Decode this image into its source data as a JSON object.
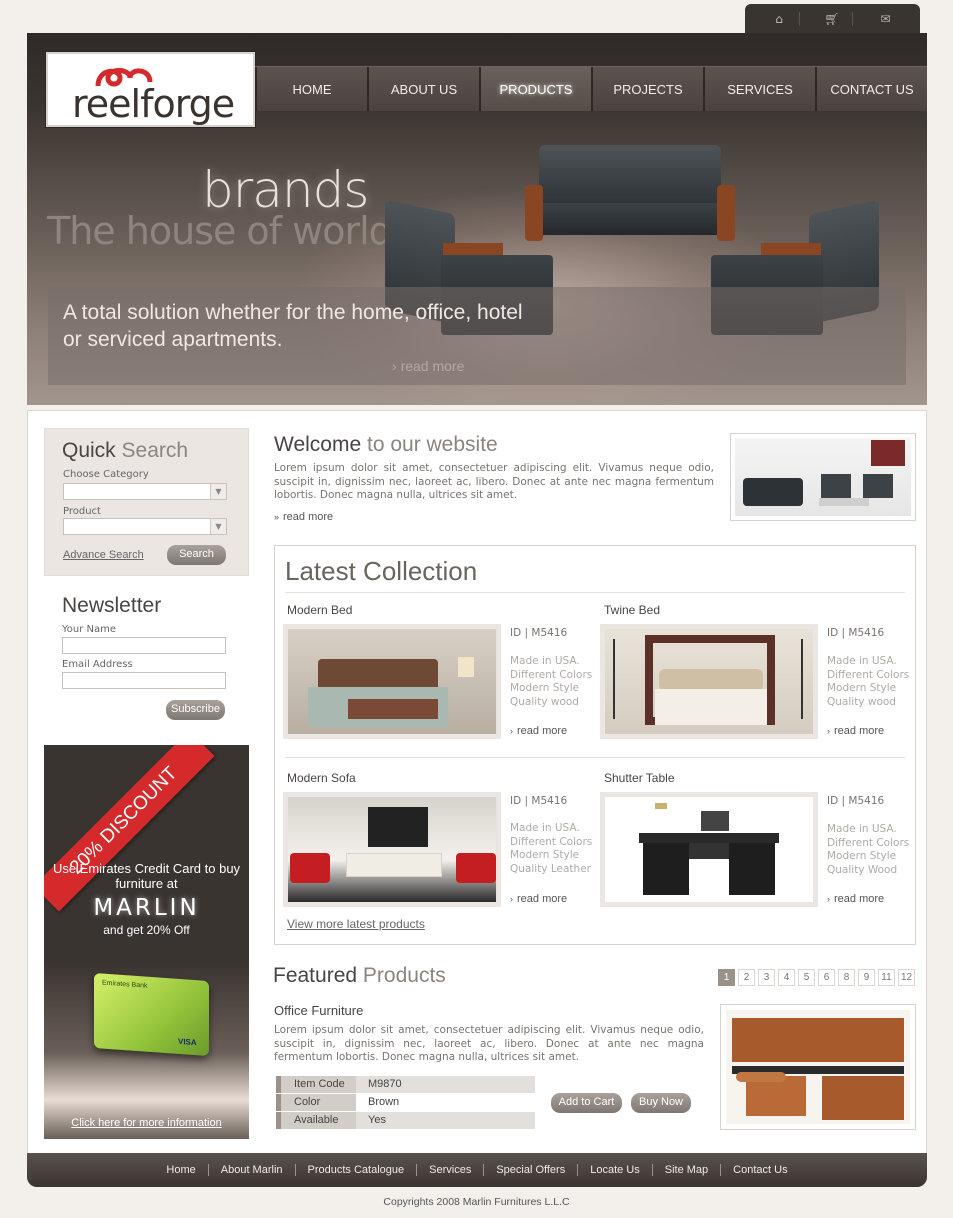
{
  "top_icons": [
    "home-icon",
    "cart-icon",
    "mail-icon"
  ],
  "logo": {
    "text": "reelforge"
  },
  "nav": [
    {
      "label": "HOME"
    },
    {
      "label": "ABOUT US"
    },
    {
      "label": "PRODUCTS",
      "active": true
    },
    {
      "label": "PROJECTS"
    },
    {
      "label": "SERVICES"
    },
    {
      "label": "CONTACT US"
    }
  ],
  "hero": {
    "brands": "brands",
    "tagline": "The house of world",
    "banner_text": "A total solution whether for the home, office, hotel or serviced apartments.",
    "read_more": "read more"
  },
  "quick_search": {
    "title_main": "Quick",
    "title_light": "Search",
    "category_label": "Choose Category",
    "product_label": "Product",
    "advance_link": "Advance Search",
    "search_button": "Search"
  },
  "newsletter": {
    "title": "Newsletter",
    "name_label": "Your Name",
    "email_label": "Email Address",
    "subscribe_button": "Subscribe"
  },
  "promo": {
    "ribbon": "20% DISCOUNT",
    "line1": "Use Emirates Credit Card to buy furniture at",
    "brand": "MARLIN",
    "line2": "and get 20% Off",
    "card_bank": "Emirates Bank",
    "card_brand": "VISA",
    "link": "Click here for more information"
  },
  "welcome": {
    "title_main": "Welcome",
    "title_light": "to our website",
    "text": "Lorem ipsum dolor sit amet, consectetuer adipiscing elit. Vivamus neque odio, suscipit in, dignissim nec, laoreet ac, libero. Donec at ante nec magna fermentum lobortis. Donec magna nulla, ultrices sit amet.",
    "read_more": "read more"
  },
  "latest": {
    "title": "Latest Collection",
    "products": [
      {
        "name": "Modern Bed",
        "id": "ID | M5416",
        "desc": [
          "Made in USA.",
          "Different Colors",
          "Modern Style",
          "Quality wood"
        ],
        "read_more": "read more"
      },
      {
        "name": "Twine Bed",
        "id": "ID | M5416",
        "desc": [
          "Made in USA.",
          "Different Colors",
          "Modern Style",
          "Quality wood"
        ],
        "read_more": "read more"
      },
      {
        "name": "Modern Sofa",
        "id": "ID | M5416",
        "desc": [
          "Made in USA.",
          "Different Colors",
          "Modern Style",
          "Quality Leather"
        ],
        "read_more": "read more"
      },
      {
        "name": "Shutter Table",
        "id": "ID | M5416",
        "desc": [
          "Made in USA.",
          "Different Colors",
          "Modern Style",
          "Quality Wood"
        ],
        "read_more": "read more"
      }
    ],
    "view_more": "View more latest products"
  },
  "featured": {
    "title_main": "Featured",
    "title_light": "Products",
    "pages": [
      "1",
      "2",
      "3",
      "4",
      "5",
      "6",
      "8",
      "9",
      "11",
      "12"
    ],
    "active_page": "1",
    "product_title": "Office Furniture",
    "text": "Lorem ipsum dolor sit amet, consectetuer adipiscing elit. Vivamus neque odio, suscipit in, dignissim nec, laoreet ac, libero. Donec at ante nec magna fermentum lobortis. Donec magna nulla, ultrices sit amet.",
    "spec": [
      {
        "key": "Item  Code",
        "value": "M9870"
      },
      {
        "key": "Color",
        "value": "Brown"
      },
      {
        "key": "Available",
        "value": "Yes"
      }
    ],
    "add_to_cart": "Add to Cart",
    "buy_now": "Buy Now"
  },
  "footer": {
    "links": [
      "Home",
      "About Marlin",
      "Products Catalogue",
      "Services",
      "Special Offers",
      "Locate Us",
      "Site Map",
      "Contact Us"
    ],
    "copyright": "Copyrights 2008 Marlin Furnitures L.L.C"
  }
}
